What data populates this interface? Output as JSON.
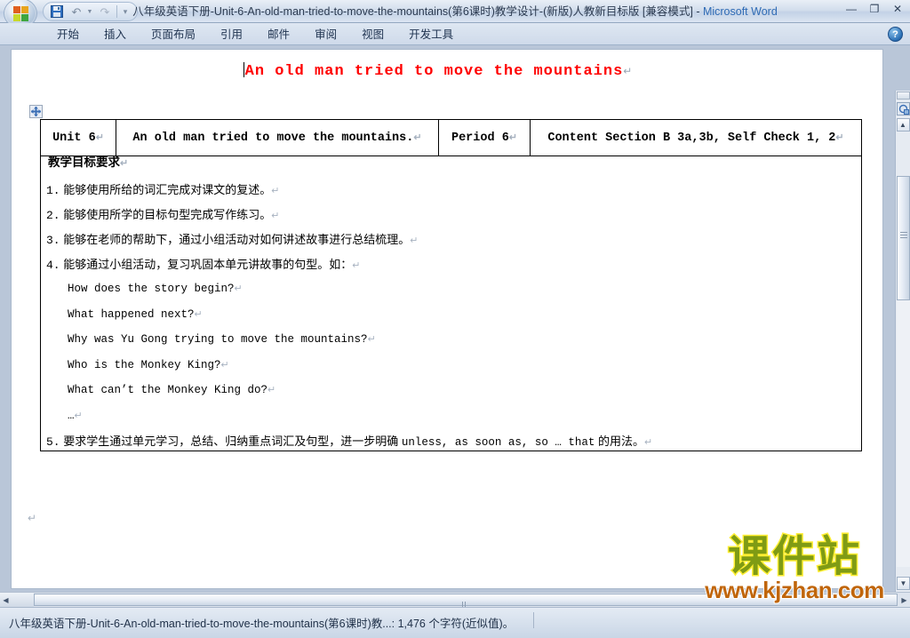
{
  "window": {
    "title_doc": "八年级英语下册-Unit-6-An-old-man-tried-to-move-the-mountains(第6课时)教学设计-(新版)人教新目标版 [兼容模式]",
    "title_sep": " - ",
    "title_app": "Microsoft Word",
    "minimize": "—",
    "restore": "❐",
    "close": "✕"
  },
  "quick_access": {
    "save_icon": "save-icon",
    "undo_icon": "undo-icon",
    "redo_icon": "redo-icon",
    "customize_icon": "customize-qat-icon"
  },
  "ribbon": {
    "tabs": [
      {
        "label": "开始"
      },
      {
        "label": "插入"
      },
      {
        "label": "页面布局"
      },
      {
        "label": "引用"
      },
      {
        "label": "邮件"
      },
      {
        "label": "审阅"
      },
      {
        "label": "视图"
      },
      {
        "label": "开发工具"
      }
    ],
    "help_label": "?"
  },
  "document": {
    "title": "An old man tried to move the mountains",
    "title_pilcrow": "↵",
    "table": {
      "header": [
        {
          "text": "Unit 6",
          "pilcrow": "↵"
        },
        {
          "text": "An old man tried to move the mountains.",
          "pilcrow": "↵"
        },
        {
          "text": "Period 6",
          "pilcrow": "↵"
        },
        {
          "text": "Content  Section B  3a,3b, Self Check 1, 2",
          "pilcrow": "↵"
        }
      ],
      "body": [
        {
          "kind": "heading",
          "num": "",
          "text": "教学目标要求",
          "pilcrow": "↵"
        },
        {
          "kind": "item",
          "num": "1.",
          "text": "能够使用所给的词汇完成对课文的复述。",
          "pilcrow": "↵"
        },
        {
          "kind": "item",
          "num": "2.",
          "text": "能够使用所学的目标句型完成写作练习。",
          "pilcrow": "↵"
        },
        {
          "kind": "item",
          "num": "3.",
          "text": "能够在老师的帮助下，通过小组活动对如何讲述故事进行总结梳理。",
          "pilcrow": "↵"
        },
        {
          "kind": "item",
          "num": "4.",
          "text": "能够通过小组活动，复习巩固本单元讲故事的句型。如：",
          "pilcrow": "↵"
        },
        {
          "kind": "english",
          "num": "",
          "text": "How does the story begin?",
          "pilcrow": "↵"
        },
        {
          "kind": "english",
          "num": "",
          "text": "What happened next?",
          "pilcrow": "↵"
        },
        {
          "kind": "english",
          "num": "",
          "text": "Why was Yu Gong trying to move the mountains?",
          "pilcrow": "↵"
        },
        {
          "kind": "english",
          "num": "",
          "text": "Who is the Monkey King?",
          "pilcrow": "↵"
        },
        {
          "kind": "english",
          "num": "",
          "text": "What can’t the Monkey King do?",
          "pilcrow": "↵"
        },
        {
          "kind": "english",
          "num": "",
          "text": "…",
          "pilcrow": "↵"
        },
        {
          "kind": "item-mixed",
          "num": "5.",
          "text_cn_1": "要求学生通过单元学习，总结、归纳重点词汇及句型，进一步明确 ",
          "text_en": "unless, as soon as, so … that",
          "text_cn_2": " 的用法。",
          "pilcrow": "↵"
        }
      ]
    },
    "tail_pilcrow": "↵",
    "table_move_handle": "table-move-handle"
  },
  "scrollbars": {
    "v_up": "▲",
    "v_down": "▼",
    "v_prev_page": "⯅",
    "v_select_browse": "○",
    "v_next_page": "⯆",
    "h_left": "◀",
    "h_right": "▶"
  },
  "status_bar": {
    "text": "八年级英语下册-Unit-6-An-old-man-tried-to-move-the-mountains(第6课时)教...: 1,476 个字符(近似值)。"
  },
  "watermark": {
    "brand_cn": "课件站",
    "brand_url": "www.kjzhan.com",
    "brand_color": "#7f9b14",
    "brand_outline": "#ffee33",
    "url_color": "#c0650a"
  }
}
